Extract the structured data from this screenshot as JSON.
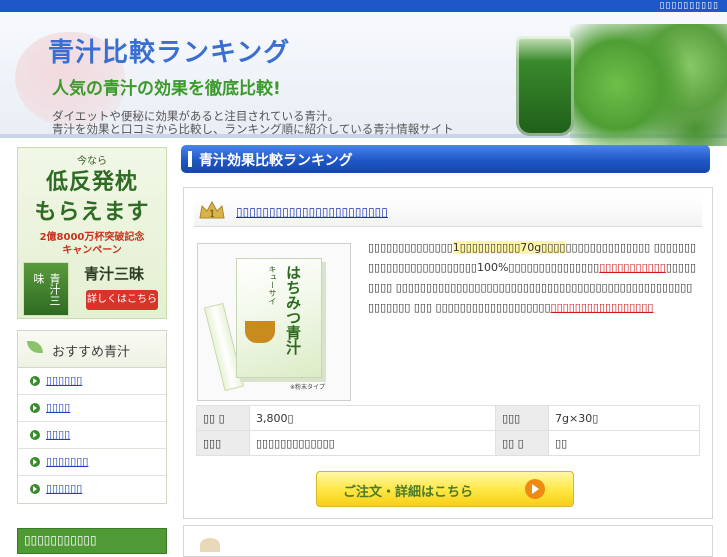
{
  "topbar": {
    "link": "▯▯▯▯▯▯▯▯▯▯"
  },
  "header": {
    "title": "青汁比較ランキング",
    "tagline": "人気の青汁の効果を徹底比較!",
    "desc_line1": "ダイエットや便秘に効果があると注目されている青汁。",
    "desc_line2": "青汁を効果と口コミから比較し、ランキング順に紹介している青汁情報サイト"
  },
  "sidebar": {
    "banner": {
      "small": "今なら",
      "big1": "低反発枕",
      "big2": "もらえます",
      "red1": "2億8000万杯突破記念",
      "red2": "キャンペーン",
      "package_text": "青汁三味",
      "product_name": "青汁三昧",
      "button": "詳しくはこちら"
    },
    "menu": {
      "heading": "おすすめ青汁",
      "items": [
        {
          "label": "▯▯▯▯▯▯"
        },
        {
          "label": "▯▯▯▯"
        },
        {
          "label": "▯▯▯▯"
        },
        {
          "label": "▯▯▯▯▯▯▯"
        },
        {
          "label": "▯▯▯▯▯▯"
        }
      ]
    },
    "banner2": {
      "text": "▯▯▯▯▯▯▯▯▯▯▯"
    }
  },
  "main": {
    "heading": "青汁効果比較ランキング",
    "rank1": {
      "rank_label": "1",
      "name": "▯▯▯▯▯▯▯▯▯▯▯▯▯▯▯▯▯▯▯▯▯▯▯",
      "package_maker": "キューサイ",
      "package_name": "はちみつ青汁",
      "package_note": "※粉末タイプ",
      "description": {
        "p1": "▯▯▯▯▯▯▯▯▯▯▯▯▯▯",
        "hl": "1▯▯▯▯▯▯▯▯▯▯70g▯▯▯▯",
        "p2": "▯▯▯▯▯▯▯▯▯▯▯▯▯▯ ▯▯▯▯▯▯▯▯▯▯▯▯▯▯▯▯▯▯▯▯▯▯▯▯▯100%▯▯▯▯▯▯▯▯▯▯▯▯▯▯▯",
        "red1": "▯▯▯▯▯▯▯▯▯▯▯",
        "p3": "▯▯▯▯▯▯▯▯▯ ▯▯▯▯▯▯▯▯▯▯▯▯▯▯▯▯▯▯▯▯▯▯▯▯▯▯▯▯▯▯▯▯▯▯▯▯▯▯▯▯▯▯▯▯▯▯▯▯▯▯▯▯▯▯▯▯ ▯▯▯ ▯▯▯▯▯▯▯▯▯▯▯▯▯▯▯▯▯▯▯",
        "red2": "▯▯▯▯▯▯▯▯▯▯▯▯▯▯▯▯▯"
      },
      "specs": [
        {
          "k1": "▯▯ ▯",
          "v1": "3,800▯",
          "k2": "▯▯▯",
          "v2": "7g×30▯"
        },
        {
          "k1": "▯▯▯",
          "v1": "▯▯▯▯▯▯▯▯▯▯▯▯▯",
          "k2": "▯▯ ▯",
          "v2": "▯▯"
        }
      ],
      "order_button": "ご注文・詳細はこちら"
    }
  },
  "colors": {
    "brand_blue": "#1f57c8",
    "accent_green": "#3a9a2a",
    "highlight_red": "#d01818",
    "button_yellow": "#ffe642"
  }
}
